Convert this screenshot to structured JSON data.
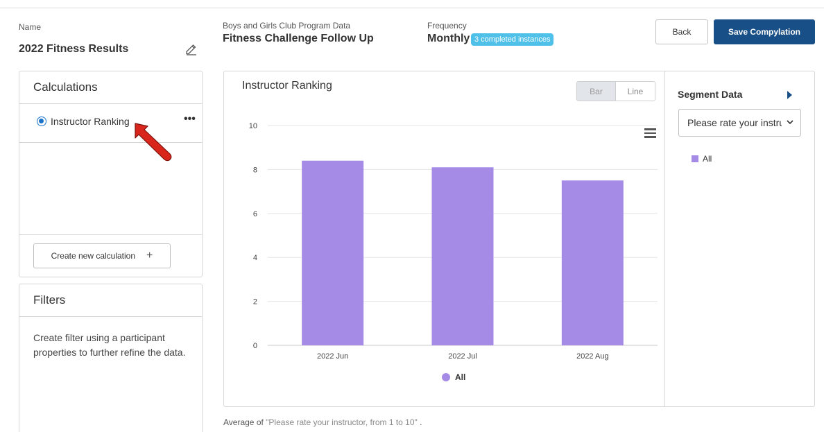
{
  "header": {
    "name_label": "Name",
    "name_value": "2022 Fitness Results",
    "dataset_label": "Boys and Girls Club Program Data",
    "dataset_value": "Fitness Challenge Follow Up",
    "frequency_label": "Frequency",
    "frequency_value": "Monthly",
    "instances_badge": "3 completed instances",
    "back_label": "Back",
    "save_label": "Save Compylation"
  },
  "calculations": {
    "title": "Calculations",
    "items": [
      {
        "label": "Instructor Ranking",
        "selected": true,
        "more": "•••"
      }
    ],
    "create_label": "Create new calculation",
    "create_icon": "plus-icon"
  },
  "filters": {
    "title": "Filters",
    "text": "Create filter using a participant properties to further refine the data."
  },
  "chart": {
    "title": "Instructor Ranking",
    "toggle": {
      "bar_label": "Bar",
      "line_label": "Line",
      "active": "Bar"
    },
    "legend_label": "All"
  },
  "segment": {
    "title": "Segment Data",
    "select_value": "Please rate your instructor, from 1 to 10",
    "legend_label": "All"
  },
  "footnote": {
    "prefix": "Average of",
    "question": "\"Please rate your instructor, from 1 to 10\"",
    "suffix": "."
  },
  "colors": {
    "accent": "#174f86",
    "badge": "#4fc1e9",
    "bar": "#a68be6",
    "annotation_arrow": "#d9261c"
  },
  "chart_data": {
    "type": "bar",
    "title": "Instructor Ranking",
    "categories": [
      "2022 Jun",
      "2022 Jul",
      "2022 Aug"
    ],
    "series": [
      {
        "name": "All",
        "values": [
          8.4,
          8.1,
          7.5
        ]
      }
    ],
    "xlabel": "",
    "ylabel": "",
    "ylim": [
      0,
      10
    ],
    "yticks": [
      0,
      2,
      4,
      6,
      8,
      10
    ],
    "grid": true,
    "legend": "bottom"
  }
}
